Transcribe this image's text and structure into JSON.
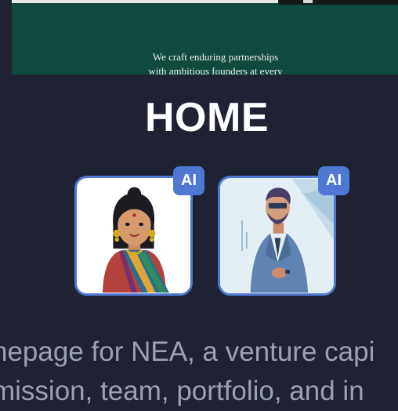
{
  "preview": {
    "tagline_line1": "We craft enduring partnerships",
    "tagline_line2": "with ambitious founders at every"
  },
  "page_title": "HOME",
  "avatars": [
    {
      "name": "woman-in-saree-avatar",
      "badge": "AI"
    },
    {
      "name": "man-in-suit-avatar",
      "badge": "AI"
    }
  ],
  "description": {
    "line1": "nepage for NEA, a venture capi",
    "line2": "mission, team, portfolio, and in"
  },
  "colors": {
    "background": "#1f2232",
    "preview_green": "#0f4a3e",
    "accent_blue": "#4f78d4",
    "muted_text": "#9ca1b0"
  }
}
